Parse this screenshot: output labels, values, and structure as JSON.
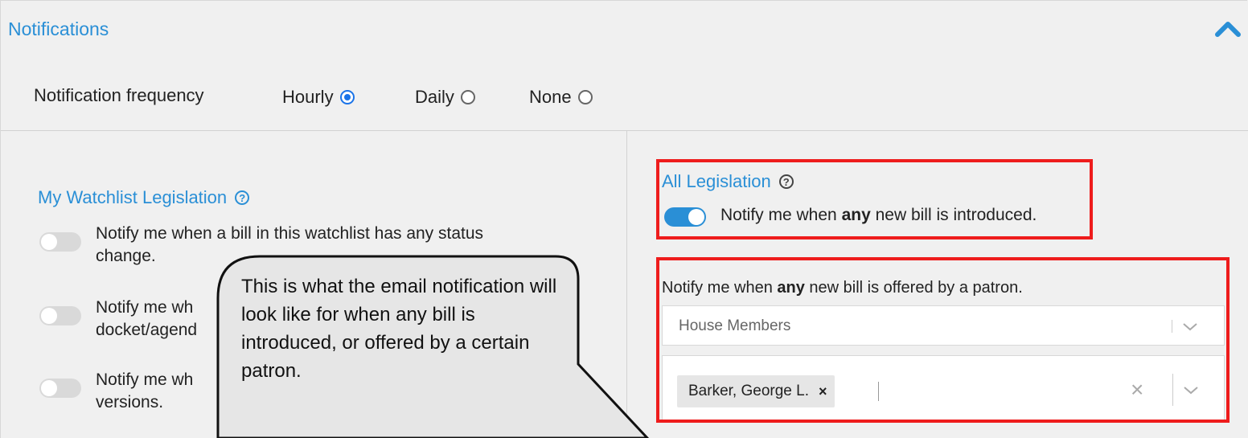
{
  "header": {
    "title": "Notifications"
  },
  "frequency": {
    "label": "Notification frequency",
    "options": [
      {
        "label": "Hourly",
        "checked": true
      },
      {
        "label": "Daily",
        "checked": false
      },
      {
        "label": "None",
        "checked": false
      }
    ]
  },
  "watchlist": {
    "title": "My Watchlist Legislation",
    "items": [
      {
        "line1": "Notify me when a bill in this watchlist has any status",
        "line2": "change.",
        "on": false
      },
      {
        "line1": "Notify me wh",
        "line2": "docket/agend",
        "on": false
      },
      {
        "line1": "Notify me wh",
        "line2": "versions.",
        "on": false
      }
    ]
  },
  "all_legislation": {
    "title": "All Legislation",
    "toggle_pre": "Notify me when ",
    "toggle_bold": "any",
    "toggle_post": " new bill is introduced.",
    "on": true
  },
  "patron": {
    "label_pre": "Notify me when ",
    "label_bold": "any",
    "label_post": " new bill is offered by a patron.",
    "chamber_placeholder": "House Members",
    "selected_tag": "Barker, George L.",
    "tag_remove": "×",
    "clear": "×"
  },
  "callout": {
    "text": "This is what the email notification will look like for when any bill is introduced, or offered by a certain patron."
  },
  "colors": {
    "accent": "#2a8fd6",
    "highlight": "#ee1c1c",
    "callout_fill": "#e6e6e6"
  }
}
